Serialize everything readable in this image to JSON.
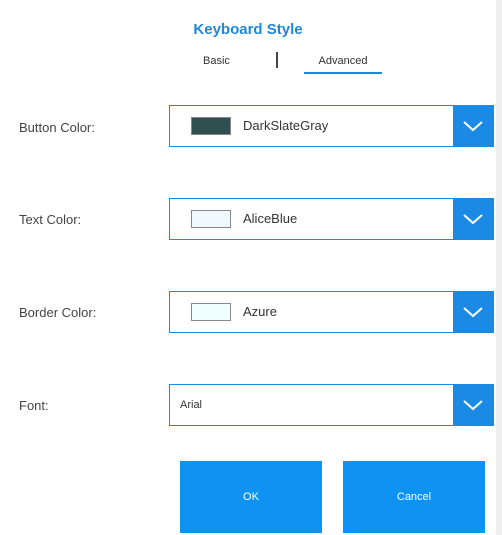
{
  "title": "Keyboard Style",
  "tabs": {
    "basic": "Basic",
    "advanced": "Advanced"
  },
  "rows": {
    "button_color": {
      "label": "Button Color:",
      "value": "DarkSlateGray",
      "swatch": "#2f4f4f"
    },
    "text_color": {
      "label": "Text Color:",
      "value": "AliceBlue",
      "swatch": "#f0f8ff"
    },
    "border_color": {
      "label": "Border Color:",
      "value": "Azure",
      "swatch": "#f0ffff"
    },
    "font": {
      "label": "Font:",
      "value": "Arial"
    }
  },
  "buttons": {
    "ok": "OK",
    "cancel": "Cancel"
  },
  "colors": {
    "accent": "#1a8ae5",
    "title": "#1e88d8",
    "button": "#0f93f3"
  }
}
